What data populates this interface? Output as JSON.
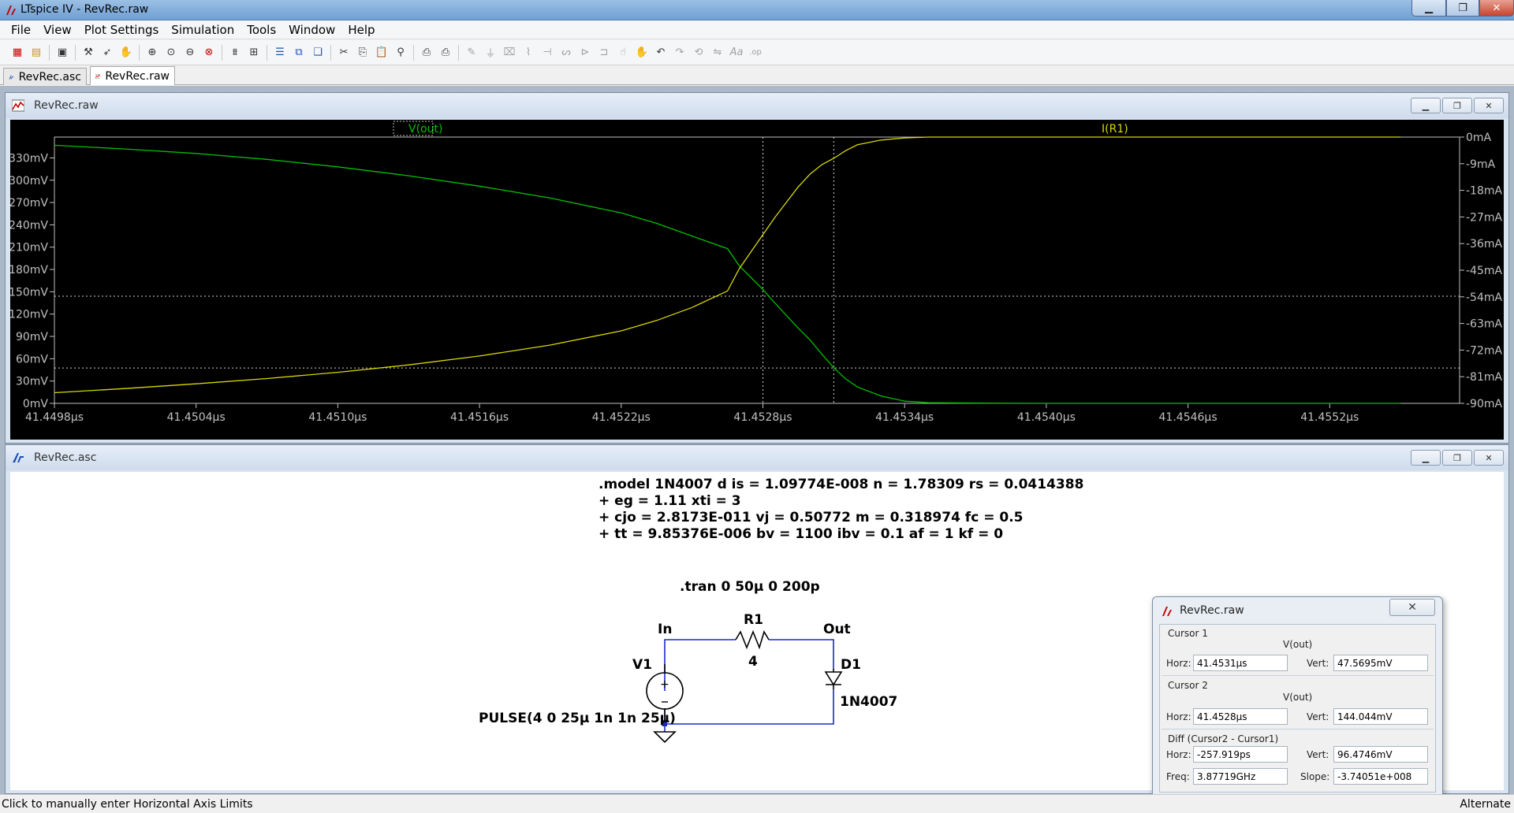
{
  "app": {
    "title": "LTspice IV - RevRec.raw",
    "colors": {
      "plot_bg": "#000000",
      "trace_vout": "#00c000",
      "trace_ir1": "#d8d800",
      "axis": "#c0c0c0"
    }
  },
  "menu": [
    "File",
    "View",
    "Plot Settings",
    "Simulation",
    "Tools",
    "Window",
    "Help"
  ],
  "toolbar": {
    "icons": [
      "new-schematic-icon",
      "open-icon",
      "save-icon",
      "control-panel-icon",
      "run-icon",
      "halt-icon",
      "zoom-in-icon",
      "zoom-box-icon",
      "zoom-out-icon",
      "zoom-fit-icon",
      "autorange-icon",
      "grid-icon",
      "tile-horizontal-icon",
      "tile-vertical-icon",
      "cascade-icon",
      "cut-icon",
      "copy-icon",
      "paste-icon",
      "find-icon",
      "print-preview-icon",
      "print-icon",
      "wire-icon",
      "ground-icon",
      "label-icon",
      "resistor-icon",
      "capacitor-icon",
      "inductor-icon",
      "diode-icon",
      "component-icon",
      "move-icon",
      "drag-icon",
      "undo-icon",
      "redo-icon",
      "rotate-icon",
      "mirror-icon",
      "text-icon",
      "spice-directive-icon"
    ]
  },
  "tabs": [
    {
      "label": "RevRec.asc",
      "icon": "schematic-icon"
    },
    {
      "label": "RevRec.raw",
      "icon": "waveform-icon"
    }
  ],
  "plot_window": {
    "title": "RevRec.raw",
    "trace_labels": {
      "left": "V(out)",
      "right": "I(R1)"
    }
  },
  "chart_data": {
    "type": "line",
    "xlabel": "",
    "ylabel": "",
    "x_ticks": [
      "41.4498µs",
      "41.4504µs",
      "41.4510µs",
      "41.4516µs",
      "41.4522µs",
      "41.4528µs",
      "41.4534µs",
      "41.4540µs",
      "41.4546µs",
      "41.4552µs"
    ],
    "x_tick_values": [
      41.4498,
      41.4504,
      41.451,
      41.4516,
      41.4522,
      41.4528,
      41.4534,
      41.454,
      41.4546,
      41.4552
    ],
    "xlim": [
      41.4498,
      41.45575
    ],
    "y_left_ticks": [
      "330mV",
      "300mV",
      "270mV",
      "240mV",
      "210mV",
      "180mV",
      "150mV",
      "120mV",
      "90mV",
      "60mV",
      "30mV",
      "0mV"
    ],
    "y_left_tick_values": [
      330,
      300,
      270,
      240,
      210,
      180,
      150,
      120,
      90,
      60,
      30,
      0
    ],
    "ylim_left": [
      0,
      358
    ],
    "y_right_ticks": [
      "0mA",
      "-9mA",
      "-18mA",
      "-27mA",
      "-36mA",
      "-45mA",
      "-54mA",
      "-63mA",
      "-72mA",
      "-81mA",
      "-90mA"
    ],
    "y_right_tick_values": [
      0,
      -9,
      -18,
      -27,
      -36,
      -45,
      -54,
      -63,
      -72,
      -81,
      -90
    ],
    "ylim_right": [
      -90,
      0
    ],
    "cursors": {
      "cursor1": {
        "x": 41.4531,
        "y": 47.5695
      },
      "cursor2": {
        "x": 41.4528,
        "y": 144.044
      }
    },
    "series": [
      {
        "name": "V(out)",
        "axis": "left",
        "x": [
          41.4498,
          41.4501,
          41.4504,
          41.4507,
          41.451,
          41.4513,
          41.4516,
          41.4519,
          41.4522,
          41.45235,
          41.4525,
          41.45265,
          41.4527,
          41.4528,
          41.45285,
          41.4529,
          41.45295,
          41.453,
          41.45305,
          41.4531,
          41.45315,
          41.4532,
          41.4533,
          41.4534,
          41.4535,
          41.4537,
          41.454,
          41.4545,
          41.455,
          41.4555
        ],
        "values": [
          347,
          342,
          336,
          328,
          318,
          306,
          292,
          276,
          256,
          242,
          225,
          208,
          185,
          153,
          135,
          118,
          101,
          85,
          66,
          48,
          33,
          22,
          10,
          3,
          1,
          0.3,
          0,
          0,
          0,
          0
        ]
      },
      {
        "name": "I(R1)",
        "axis": "right",
        "x": [
          41.4498,
          41.4501,
          41.4504,
          41.4507,
          41.451,
          41.4513,
          41.4516,
          41.4519,
          41.4522,
          41.45235,
          41.4525,
          41.45265,
          41.4527,
          41.4528,
          41.45285,
          41.4529,
          41.45295,
          41.453,
          41.45305,
          41.4531,
          41.45315,
          41.4532,
          41.4533,
          41.4534,
          41.4535,
          41.4537,
          41.454,
          41.4545,
          41.455,
          41.4555
        ],
        "values": [
          -86.4,
          -85.0,
          -83.4,
          -81.6,
          -79.5,
          -77.0,
          -74.0,
          -70.3,
          -65.5,
          -62.0,
          -57.6,
          -52.0,
          -44.5,
          -33.0,
          -27.2,
          -22.0,
          -16.8,
          -12.5,
          -9.3,
          -7.2,
          -4.6,
          -2.6,
          -1.0,
          -0.3,
          0,
          0,
          0,
          0,
          0,
          0
        ]
      }
    ]
  },
  "schematic_window": {
    "title": "RevRec.asc",
    "model_lines": [
      ".model 1N4007 d is = 1.09774E-008 n = 1.78309 rs = 0.0414388",
      "+ eg = 1.11 xti = 3",
      "+ cjo = 2.8173E-011 vj = 0.50772 m = 0.318974 fc = 0.5",
      "+ tt = 9.85376E-006 bv = 1100 ibv = 0.1 af = 1 kf = 0"
    ],
    "tran": ".tran 0 50µ 0 200p",
    "labels": {
      "in": "In",
      "out": "Out",
      "r1_name": "R1",
      "r1_value": "4",
      "v1_name": "V1",
      "v1_value": "PULSE(4 0 25µ 1n 1n 25µ)",
      "d1_name": "D1",
      "d1_value": "1N4007"
    }
  },
  "cursor_dialog": {
    "title": "RevRec.raw",
    "close_label": "✕",
    "cursor1": {
      "label": "Cursor 1",
      "trace": "V(out)",
      "horz_label": "Horz:",
      "horz": "41.4531µs",
      "vert_label": "Vert:",
      "vert": "47.5695mV"
    },
    "cursor2": {
      "label": "Cursor 2",
      "trace": "V(out)",
      "horz_label": "Horz:",
      "horz": "41.4528µs",
      "vert_label": "Vert:",
      "vert": "144.044mV"
    },
    "diff": {
      "label": "Diff (Cursor2 - Cursor1)",
      "horz_label": "Horz:",
      "horz": "-257.919ps",
      "vert_label": "Vert:",
      "vert": "96.4746mV",
      "freq_label": "Freq:",
      "freq": "3.87719GHz",
      "slope_label": "Slope:",
      "slope": "-3.74051e+008"
    }
  },
  "status": {
    "left": "Click to manually enter Horizontal Axis Limits",
    "right": "Alternate"
  }
}
